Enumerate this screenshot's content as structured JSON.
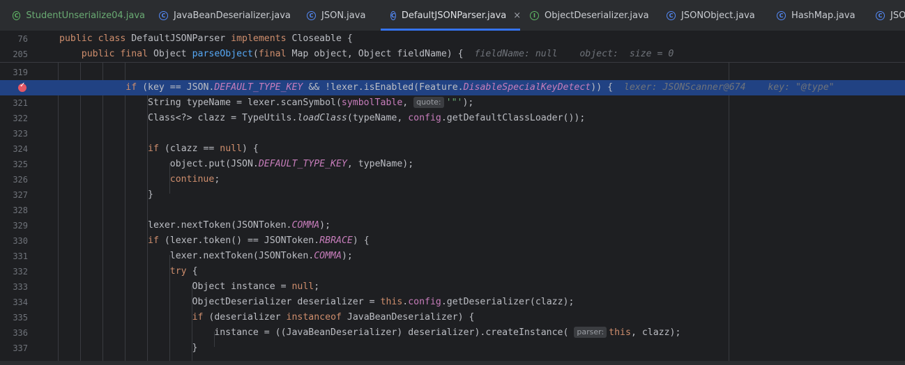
{
  "tabs": [
    {
      "label": "StudentUnserialize04.java",
      "icon": "class-icon-green"
    },
    {
      "label": "JavaBeanDeserializer.java",
      "icon": "class-icon"
    },
    {
      "label": "JSON.java",
      "icon": "class-icon"
    },
    {
      "label": "DefaultJSONParser.java",
      "icon": "class-icon",
      "active": true,
      "close": "×"
    },
    {
      "label": "ObjectDeserializer.java",
      "icon": "interface-icon"
    },
    {
      "label": "JSONObject.java",
      "icon": "class-icon"
    },
    {
      "label": "HashMap.java",
      "icon": "class-icon"
    },
    {
      "label": "JSO",
      "icon": "class-icon"
    }
  ],
  "sticky": [
    {
      "ln": "76"
    },
    {
      "ln": "205",
      "hint": "fieldName: null    object:  size = 0"
    }
  ],
  "lines": [
    {
      "ln": "319"
    },
    {
      "ln": "",
      "breakpoint": true,
      "hint": "lexer: JSONScanner@674    key: \"@type\""
    },
    {
      "ln": "321",
      "inlay": "quote:"
    },
    {
      "ln": "322"
    },
    {
      "ln": "323"
    },
    {
      "ln": "324"
    },
    {
      "ln": "325"
    },
    {
      "ln": "326"
    },
    {
      "ln": "327"
    },
    {
      "ln": "328"
    },
    {
      "ln": "329"
    },
    {
      "ln": "330"
    },
    {
      "ln": "331"
    },
    {
      "ln": "332"
    },
    {
      "ln": "333"
    },
    {
      "ln": "334"
    },
    {
      "ln": "335"
    },
    {
      "ln": "336",
      "inlay": "parser:"
    },
    {
      "ln": "337"
    }
  ],
  "colors": {
    "accent": "#3574f0",
    "highlight": "#214283",
    "breakpoint": "#e55765"
  }
}
